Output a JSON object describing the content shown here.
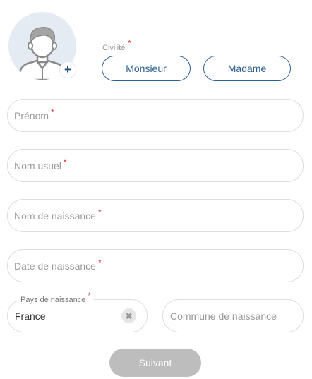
{
  "avatar": {
    "icon": "user-avatar-icon",
    "add_icon": "plus-icon",
    "add_label": "+"
  },
  "civilite": {
    "label": "Civilité",
    "required_mark": "*",
    "options": [
      "Monsieur",
      "Madame"
    ]
  },
  "fields": {
    "prenom": {
      "placeholder": "Prénom",
      "required_mark": "*"
    },
    "nom_usuel": {
      "placeholder": "Nom usuel",
      "required_mark": "*"
    },
    "nom_naissance": {
      "placeholder": "Nom de naissance",
      "required_mark": "*"
    },
    "date_naissance": {
      "placeholder": "Date de naissance",
      "required_mark": "*"
    },
    "pays_naissance": {
      "label": "Pays de naissance",
      "required_mark": "*",
      "value": "France",
      "clear_icon": "close-icon",
      "clear_label": "✖"
    },
    "commune_naissance": {
      "placeholder": "Commune de naissance"
    }
  },
  "actions": {
    "next_label": "Suivant"
  },
  "colors": {
    "primary": "#2c5f91",
    "required": "#d93636",
    "border": "#dedede",
    "disabled_button": "#bdbdbd",
    "avatar_bg": "#e4ebf2"
  }
}
